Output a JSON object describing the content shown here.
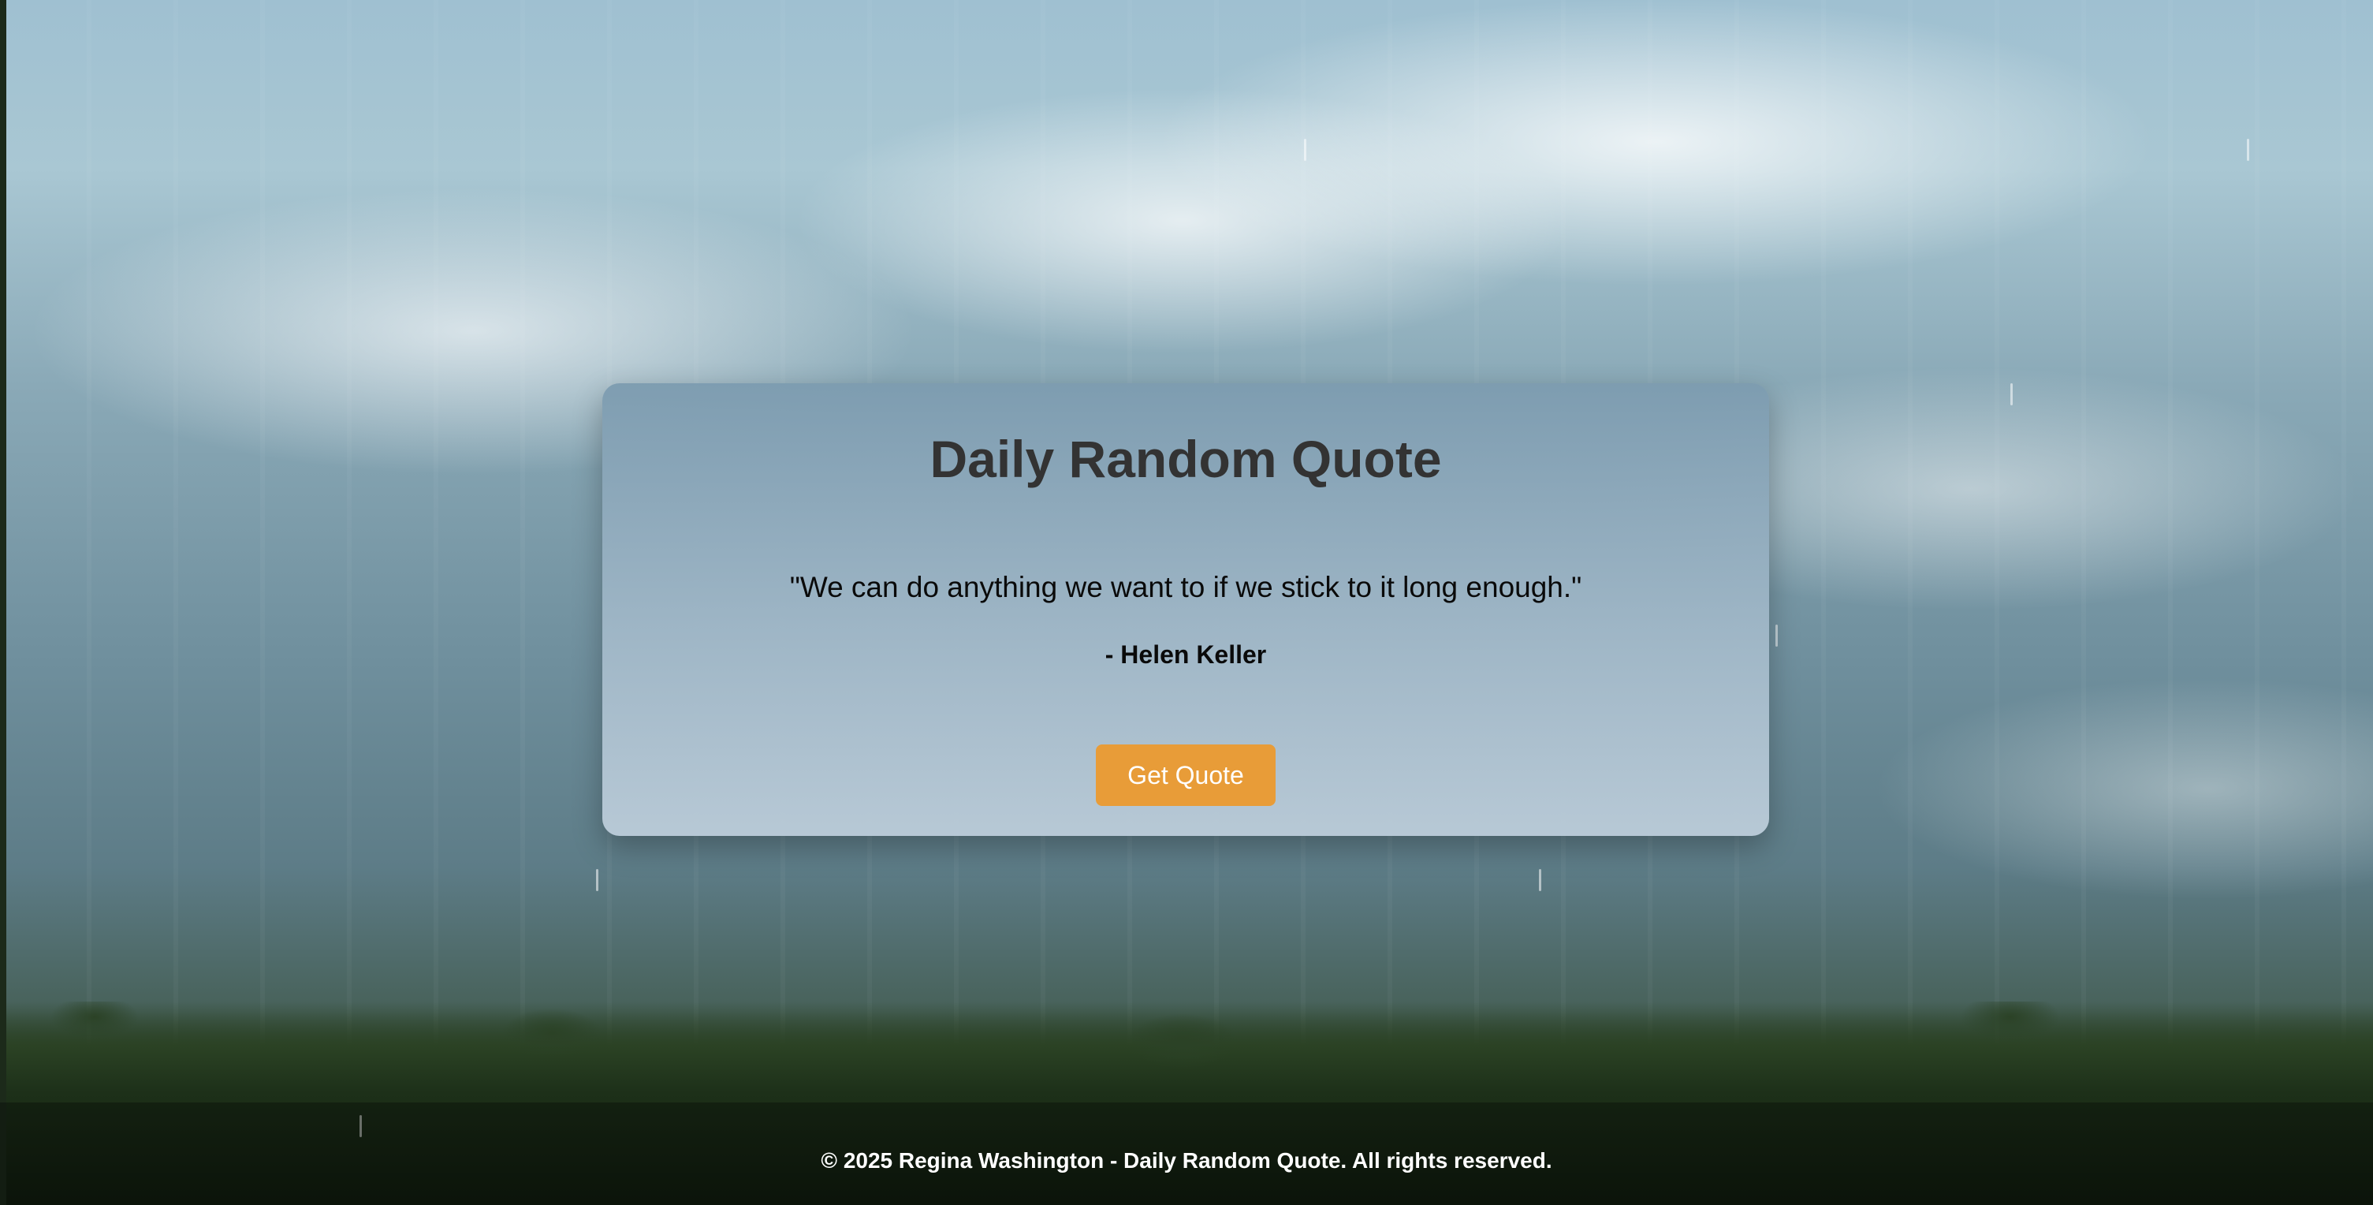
{
  "app": {
    "title": "Daily Random Quote"
  },
  "quote": {
    "text": "\"We can do anything we want to if we stick to it long enough.\"",
    "author": "- Helen Keller"
  },
  "actions": {
    "get_quote_label": "Get Quote"
  },
  "footer": {
    "text": "© 2025 Regina Washington - Daily Random Quote. All rights reserved."
  },
  "colors": {
    "button": "#e89c38",
    "title": "#333333",
    "footer_text": "#ffffff"
  },
  "background": {
    "description_icon": "cloudy-sky-background"
  }
}
